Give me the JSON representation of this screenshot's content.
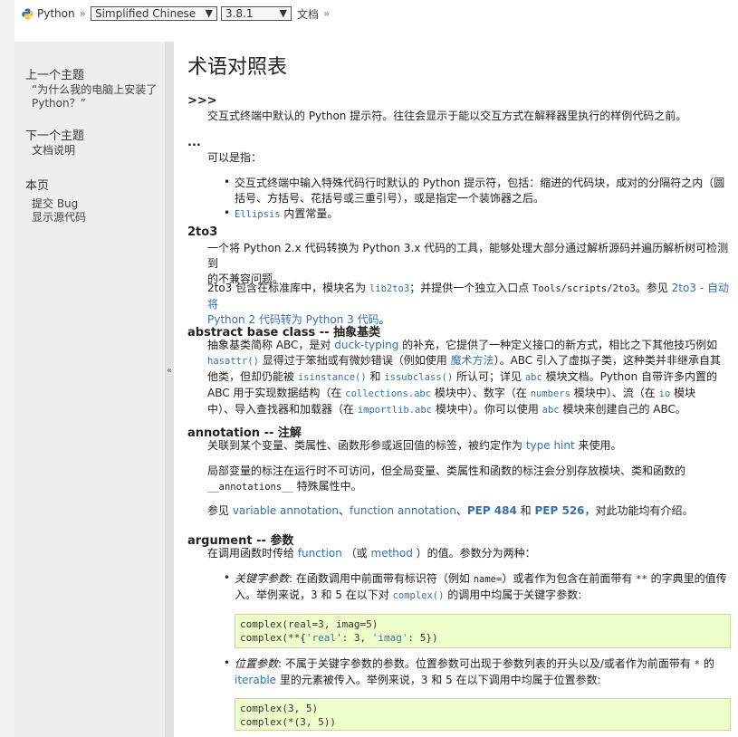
{
  "breadcrumb": {
    "python": "Python",
    "sep1": "»",
    "language": "Simplified Chinese",
    "version": "3.8.1",
    "docs": "文档",
    "sep2": "»"
  },
  "sidebar": {
    "prev_heading": "上一个主题",
    "prev_line1": "“为什么我的电脑上安装了",
    "prev_line2": "Python？”",
    "next_heading": "下一个主题",
    "next_link": "文档说明",
    "page_heading": "本页",
    "report_bug": "提交 Bug",
    "show_source": "显示源代码",
    "collapse": "«"
  },
  "page": {
    "title": "术语对照表",
    "prompt": {
      "term": ">>>",
      "desc": "交互式终端中默认的 Python 提示符。往往会显示于能以交互方式在解释器里执行的样例代码之前。"
    },
    "ellipsis": {
      "term": "...",
      "intro": "可以是指：",
      "b1_line1": "交互式终端中输入特殊代码行时默认的 Python 提示符，包括：缩进的代码块，成对的分隔符之内（圆",
      "b1_line2": "括号、方括号、花括号或三重引号），或是指定一个装饰器之后。",
      "b2_code": "Ellipsis",
      "b2_text": " 内置常量。"
    },
    "to3": {
      "term": "2to3",
      "p1_line1": "一个将 Python 2.x 代码转换为 Python 3.x 代码的工具，能够处理大部分通过解析源码并遍历解析树可检测到",
      "p1_line2": "的不兼容问题。",
      "p2_a": "2to3 包含在标准库中，模块名为 ",
      "p2_code": "lib2to3",
      "p2_b": "；并提供一个独立入口点 ",
      "p2_path": "Tools/scripts/2to3",
      "p2_c": "。参见 ",
      "p2_link1": "2to3 - 自动将",
      "p2_link2": "Python 2 代码转为 Python 3 代码",
      "p2_d": "。"
    },
    "abc": {
      "term": "abstract base class -- 抽象基类",
      "l1_a": "抽象基类简称 ABC，是对 ",
      "l1_link": "duck-typing",
      "l1_b": " 的补充，它提供了一种定义接口的新方式，相比之下其他技巧例如",
      "l2_code": "hasattr()",
      "l2_a": " 显得过于笨拙或有微妙错误（例如使用 ",
      "l2_link": "魔术方法",
      "l2_b": "）。ABC 引入了虚拟子类，这种类并非继承自其",
      "l3_a": "他类，但却仍能被 ",
      "l3_code1": "isinstance()",
      "l3_b": " 和 ",
      "l3_code2": "issubclass()",
      "l3_c": " 所认可；详见 ",
      "l3_code3": "abc",
      "l3_d": " 模块文档。Python 自带许多内置的",
      "l4_a": "ABC 用于实现数据结构（在 ",
      "l4_code1": "collections.abc",
      "l4_b": " 模块中）、数字（在 ",
      "l4_code2": "numbers",
      "l4_c": " 模块中）、流（在 ",
      "l4_code3": "io",
      "l4_d": " 模块",
      "l5_a": "中）、导入查找器和加载器（在 ",
      "l5_code1": "importlib.abc",
      "l5_b": " 模块中）。你可以使用 ",
      "l5_code2": "abc",
      "l5_c": " 模块来创建自己的 ABC。"
    },
    "annotation": {
      "term": "annotation -- 注解",
      "p1_a": "关联到某个变量、类属性、函数形参或返回值的标签，被约定作为 ",
      "p1_link": "type hint",
      "p1_b": " 来使用。",
      "p2_line1": "局部变量的标注在运行时不可访问，但全局变量、类属性和函数的标注会分别存放模块、类和函数的",
      "p2_code": "__annotations__",
      "p2_b": " 特殊属性中。",
      "p3_a": "参见 ",
      "p3_link1": "variable annotation",
      "p3_b": "、",
      "p3_link2": "function annotation",
      "p3_c": "、",
      "p3_link3": "PEP 484",
      "p3_d": " 和 ",
      "p3_link4": "PEP 526",
      "p3_e": "，对此功能均有介绍。"
    },
    "argument": {
      "term": "argument -- 参数",
      "intro_a": "在调用函数时传给 ",
      "intro_link1": "function",
      "intro_b": " （或 ",
      "intro_link2": "method",
      "intro_c": " ）的值。参数分为两种：",
      "kw_em": "关键字参数",
      "kw_a": ": 在函数调用中前面带有标识符（例如 ",
      "kw_code1": "name=",
      "kw_b": "）或者作为包含在前面带有 ",
      "kw_code2": "**",
      "kw_c": " 的字典里的值传",
      "kw_line2_a": "入。举例来说，3 和 5 在以下对 ",
      "kw_code3": "complex()",
      "kw_line2_b": " 的调用中均属于关键字参数:",
      "code1_l1": "complex(real=3, imag=5)",
      "code1_l2a": "complex(**{",
      "code1_l2s1": "'real'",
      "code1_l2b": ": 3, ",
      "code1_l2s2": "'imag'",
      "code1_l2c": ": 5})",
      "pos_em": "位置参数",
      "pos_a": ": 不属于关键字参数的参数。位置参数可出现于参数列表的开头以及/或者作为前面带有 ",
      "pos_code": "*",
      "pos_b": " 的",
      "pos_line2_link": "iterable",
      "pos_line2_a": " 里的元素被传入。举例来说，3 和 5 在以下调用中均属于位置参数:",
      "code2_l1": "complex(3, 5)",
      "code2_l2": "complex(*(3, 5))"
    }
  }
}
